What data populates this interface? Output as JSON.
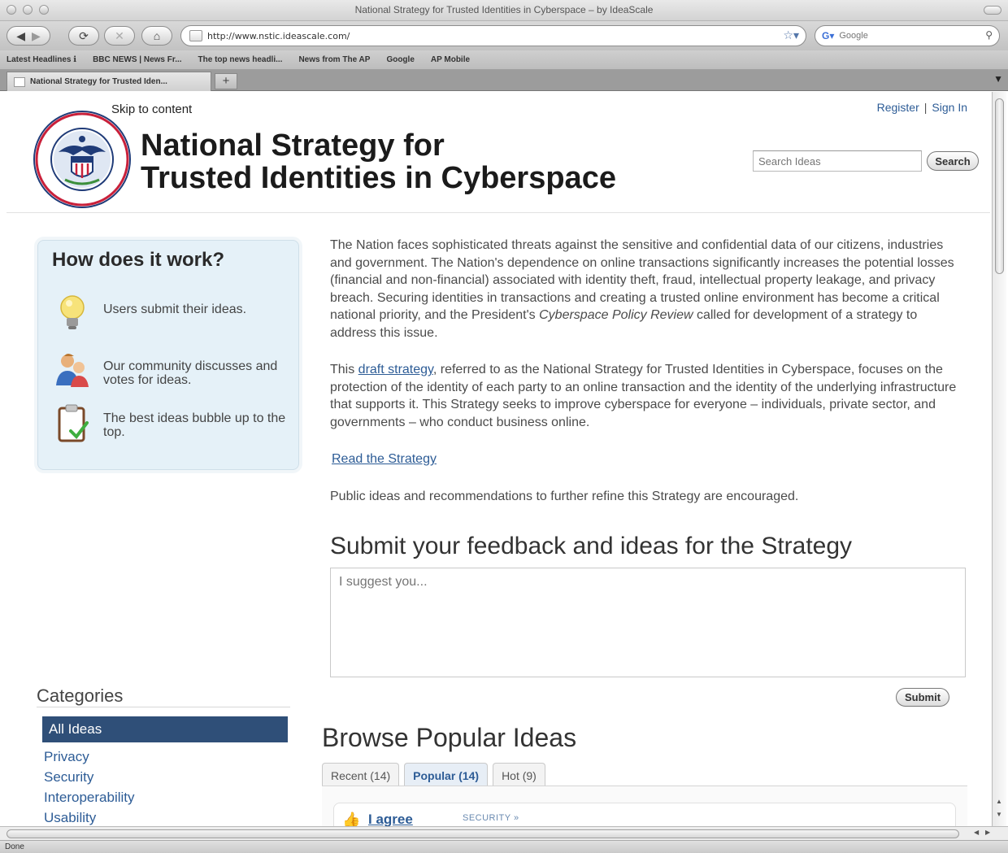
{
  "browser": {
    "window_title": "National Strategy for Trusted Identities in Cyberspace – by IdeaScale",
    "url": "http://www.nstic.ideascale.com/",
    "search_placeholder": "Google",
    "bookmarks": [
      "Latest Headlines ℹ",
      "BBC NEWS | News Fr...",
      "The top news headli...",
      "News from The AP",
      "Google",
      "AP Mobile"
    ],
    "tab_label": "National Strategy for Trusted Iden...",
    "new_tab": "+",
    "status": "Done"
  },
  "header": {
    "skip_link": "Skip to content",
    "register": "Register",
    "separator": "|",
    "sign_in": "Sign In",
    "title_line1": "National Strategy for",
    "title_line2": "Trusted Identities in Cyberspace",
    "search_placeholder": "Search Ideas",
    "search_button": "Search",
    "seal_alt": "Department of Homeland Security seal"
  },
  "how_it_works": {
    "title": "How does it work?",
    "steps": [
      {
        "text": "Users submit their ideas.",
        "icon": "lightbulb-icon"
      },
      {
        "text": "Our community discusses and votes for ideas.",
        "icon": "community-icon"
      },
      {
        "text": "The best ideas bubble up to the top.",
        "icon": "clipboard-check-icon"
      }
    ]
  },
  "intro": {
    "p1_a": "The Nation faces sophisticated threats against the sensitive and confidential data of our citizens, industries and government.  The Nation's dependence on online transactions significantly increases the potential losses (financial and non-financial) associated with identity theft, fraud, intellectual property leakage, and privacy breach. Securing identities in transactions and creating a trusted online environment has become a critical national priority, and  the President's ",
    "p1_italic": "Cyberspace Policy Review",
    "p1_b": " called for development of a strategy to address this issue.",
    "p2_a": "This ",
    "p2_link": "draft strategy",
    "p2_b": ", referred to as the National Strategy for Trusted Identities in Cyberspace, focuses on the protection of the identity of each party to an online transaction and  the identity of the underlying infrastructure that supports it. This Strategy seeks to improve cyberspace for everyone – individuals, private sector, and governments – who conduct business online.",
    "read_link": "Read the Strategy",
    "p3": "Public ideas and recommendations to further refine this Strategy are encouraged."
  },
  "feedback": {
    "heading": "Submit your feedback and ideas for the Strategy",
    "placeholder": "I suggest you...",
    "submit": "Submit"
  },
  "categories": {
    "title": "Categories",
    "active": "All Ideas",
    "items": [
      "Privacy",
      "Security",
      "Interoperability",
      "Usability"
    ]
  },
  "browse": {
    "heading": "Browse Popular Ideas",
    "tabs": [
      {
        "label": "Recent (14)"
      },
      {
        "label": "Popular (14)"
      },
      {
        "label": "Hot (9)"
      }
    ],
    "ideas": [
      {
        "title": "I agree",
        "category": "SECURITY »"
      }
    ]
  },
  "colors": {
    "link": "#2d5c96",
    "category_active_bg": "#2f4f78",
    "how_box_bg": "#e5f1f8"
  }
}
